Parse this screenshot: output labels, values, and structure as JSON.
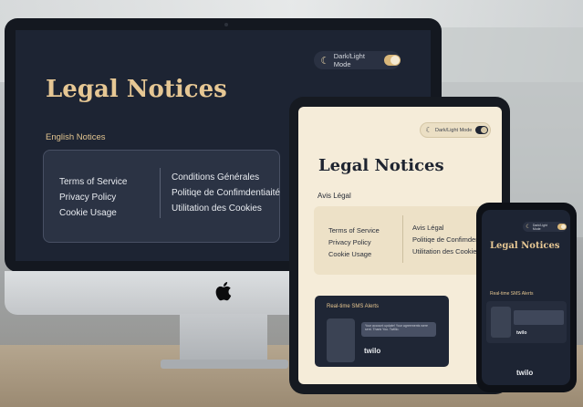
{
  "desktop": {
    "theme_toggle_label": "Dark/Light Mode",
    "title": "Legal Notices",
    "subtitle": "English Notices",
    "english_links": [
      "Terms of Service",
      "Privacy Policy",
      "Cookie Usage"
    ],
    "french_links": [
      "Conditions Générales",
      "Politiqe de Confimdentiaité",
      "Utilitation des Cookies"
    ]
  },
  "tablet": {
    "theme_toggle_label": "Dark/Light Mode",
    "title": "Legal Notices",
    "subtitle": "Avis Légal",
    "english_links": [
      "Terms of Service",
      "Privacy Policy",
      "Cookie Usage"
    ],
    "french_links": [
      "Avis Légal",
      "Politiqe de Confimdenfiar",
      "Utilitation des Cookies"
    ],
    "sms_card": {
      "title": "Real-time SMS Alerts",
      "message": "Your account update! Your agreements were sent. Thank You. Twillio.",
      "brand": "twilo"
    }
  },
  "phone": {
    "theme_toggle_label": "Dark/Light Mode",
    "title": "Legal Notices",
    "subtitle": "Real-time SMS Alerts",
    "brand_small": "twilo",
    "brand": "twilo"
  },
  "colors": {
    "dark_bg": "#1d2433",
    "accent_gold": "#e6c794",
    "cream": "#f5ecd9"
  }
}
